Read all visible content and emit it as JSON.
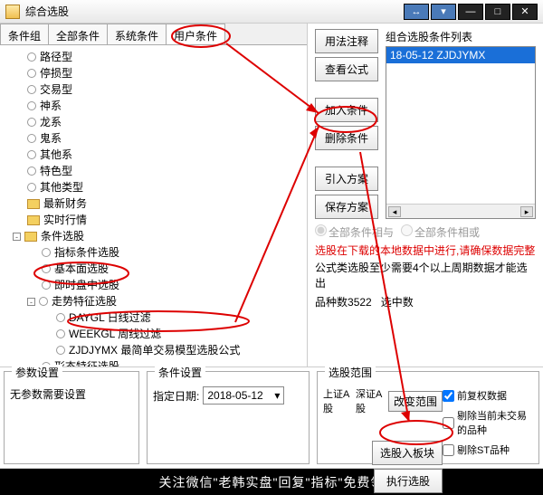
{
  "window": {
    "title": "综合选股"
  },
  "tabs": [
    "条件组",
    "全部条件",
    "系统条件",
    "用户条件"
  ],
  "tree": {
    "items_top": [
      "路径型",
      "停损型",
      "交易型",
      "神系",
      "龙系",
      "鬼系",
      "其他系",
      "特色型",
      "其他类型"
    ],
    "folders": [
      "最新财务",
      "实时行情"
    ],
    "cond_root": "条件选股",
    "cond_children": [
      "指标条件选股",
      "基本面选股",
      "即时盘中选股"
    ],
    "trend_root": "走势特征选股",
    "trend_children": [
      "DAYGL 日线过滤",
      "WEEKGL 周线过滤",
      "ZJDJYMX 最简单交易模型选股公式"
    ],
    "shape": "形态特征选股"
  },
  "buttons": {
    "usage": "用法注释",
    "view_formula": "查看公式",
    "add_cond": "加入条件",
    "del_cond": "删除条件",
    "import_plan": "引入方案",
    "save_plan": "保存方案",
    "change_range": "改变范围",
    "to_block": "选股入板块",
    "run": "执行选股"
  },
  "list": {
    "label": "组合选股条件列表",
    "item": "18-05-12 ZJDJYMX"
  },
  "radios": {
    "and": "全部条件相与",
    "or": "全部条件相或"
  },
  "hint_red": "选股在下载的本地数据中进行,请确保数据完整",
  "hint_info": "公式类选股至少需要4个以上周期数据才能选出",
  "counts": {
    "variety_label": "品种数",
    "variety_val": "3522",
    "selected_label": "选中数"
  },
  "group_param": {
    "title": "参数设置",
    "text": "无参数需要设置"
  },
  "group_cond": {
    "title": "条件设置",
    "date_label": "指定日期:",
    "date_value": "2018-05-12"
  },
  "group_range": {
    "title": "选股范围",
    "markets": [
      "上证A股",
      "深证A股"
    ],
    "chk_fq": "前复权数据",
    "chk_stop": "剔除当前未交易的品种",
    "chk_st": "剔除ST品种"
  },
  "footer": "关注微信\"老韩实盘\"回复\"指标\"免费领"
}
